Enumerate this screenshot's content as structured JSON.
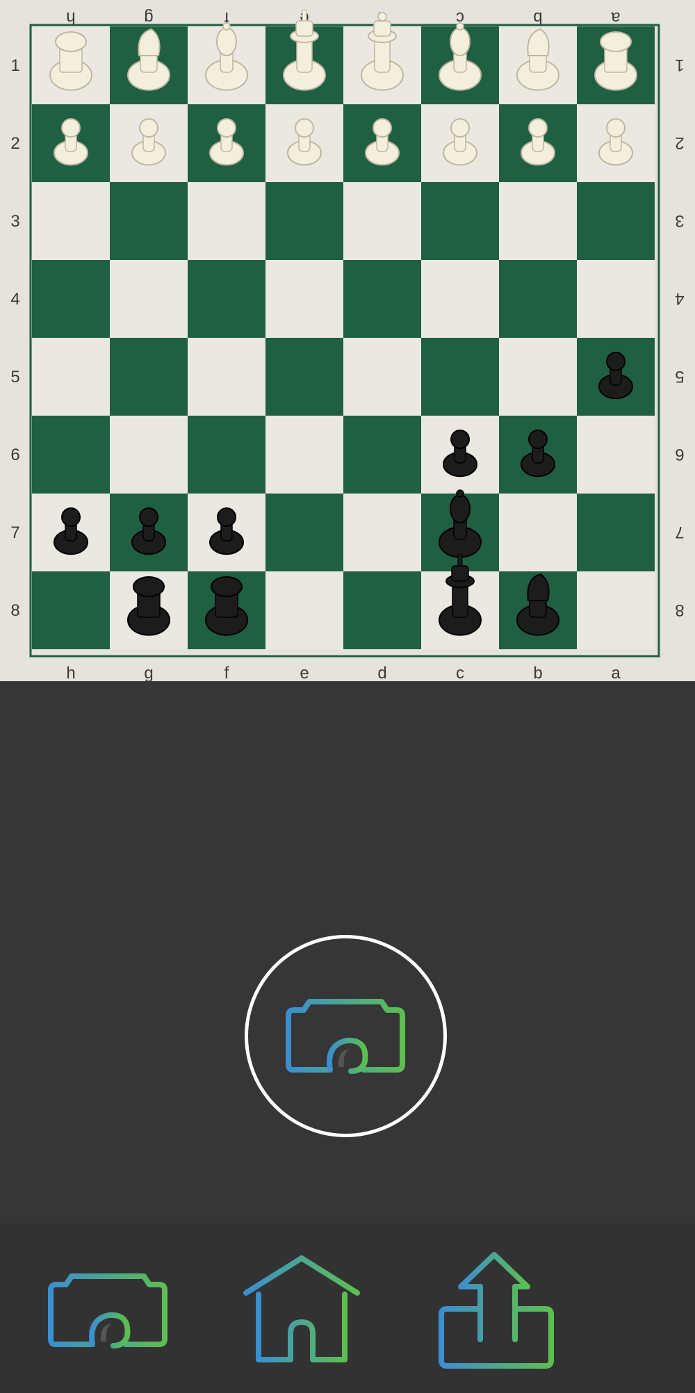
{
  "board": {
    "file_labels": [
      "h",
      "g",
      "f",
      "e",
      "d",
      "c",
      "b",
      "a"
    ],
    "rank_labels": [
      "1",
      "2",
      "3",
      "4",
      "5",
      "6",
      "7",
      "8"
    ],
    "colors": {
      "dark_square": "#1f5f42",
      "light_square": "#ebe8e1",
      "white_piece": "#f3efdc",
      "black_piece": "#1c1c1c"
    },
    "pieces": [
      {
        "square": "h1",
        "type": "rook",
        "color": "white"
      },
      {
        "square": "g1",
        "type": "knight",
        "color": "white"
      },
      {
        "square": "f1",
        "type": "bishop",
        "color": "white"
      },
      {
        "square": "e1",
        "type": "king",
        "color": "white"
      },
      {
        "square": "d1",
        "type": "queen",
        "color": "white"
      },
      {
        "square": "c1",
        "type": "bishop",
        "color": "white"
      },
      {
        "square": "b1",
        "type": "knight",
        "color": "white"
      },
      {
        "square": "a1",
        "type": "rook",
        "color": "white"
      },
      {
        "square": "h2",
        "type": "pawn",
        "color": "white"
      },
      {
        "square": "g2",
        "type": "pawn",
        "color": "white"
      },
      {
        "square": "f2",
        "type": "pawn",
        "color": "white"
      },
      {
        "square": "e2",
        "type": "pawn",
        "color": "white"
      },
      {
        "square": "d2",
        "type": "pawn",
        "color": "white"
      },
      {
        "square": "c2",
        "type": "pawn",
        "color": "white"
      },
      {
        "square": "b2",
        "type": "pawn",
        "color": "white"
      },
      {
        "square": "a2",
        "type": "pawn",
        "color": "white"
      },
      {
        "square": "a5",
        "type": "pawn",
        "color": "black"
      },
      {
        "square": "c6",
        "type": "pawn",
        "color": "black"
      },
      {
        "square": "b6",
        "type": "pawn",
        "color": "black"
      },
      {
        "square": "h7",
        "type": "pawn",
        "color": "black"
      },
      {
        "square": "g7",
        "type": "pawn",
        "color": "black"
      },
      {
        "square": "f7",
        "type": "pawn",
        "color": "black"
      },
      {
        "square": "c7",
        "type": "bishop",
        "color": "black"
      },
      {
        "square": "g8",
        "type": "rook",
        "color": "black"
      },
      {
        "square": "f8",
        "type": "rook",
        "color": "black"
      },
      {
        "square": "c8",
        "type": "king",
        "color": "black"
      },
      {
        "square": "b8",
        "type": "knight",
        "color": "black"
      }
    ]
  },
  "shutter": {
    "icon": "camera-icon"
  },
  "navbar": {
    "items": [
      {
        "icon": "camera-icon"
      },
      {
        "icon": "home-icon"
      },
      {
        "icon": "share-icon"
      }
    ],
    "gradient": {
      "start": "#3b8fcf",
      "end": "#5cbf4f"
    }
  }
}
